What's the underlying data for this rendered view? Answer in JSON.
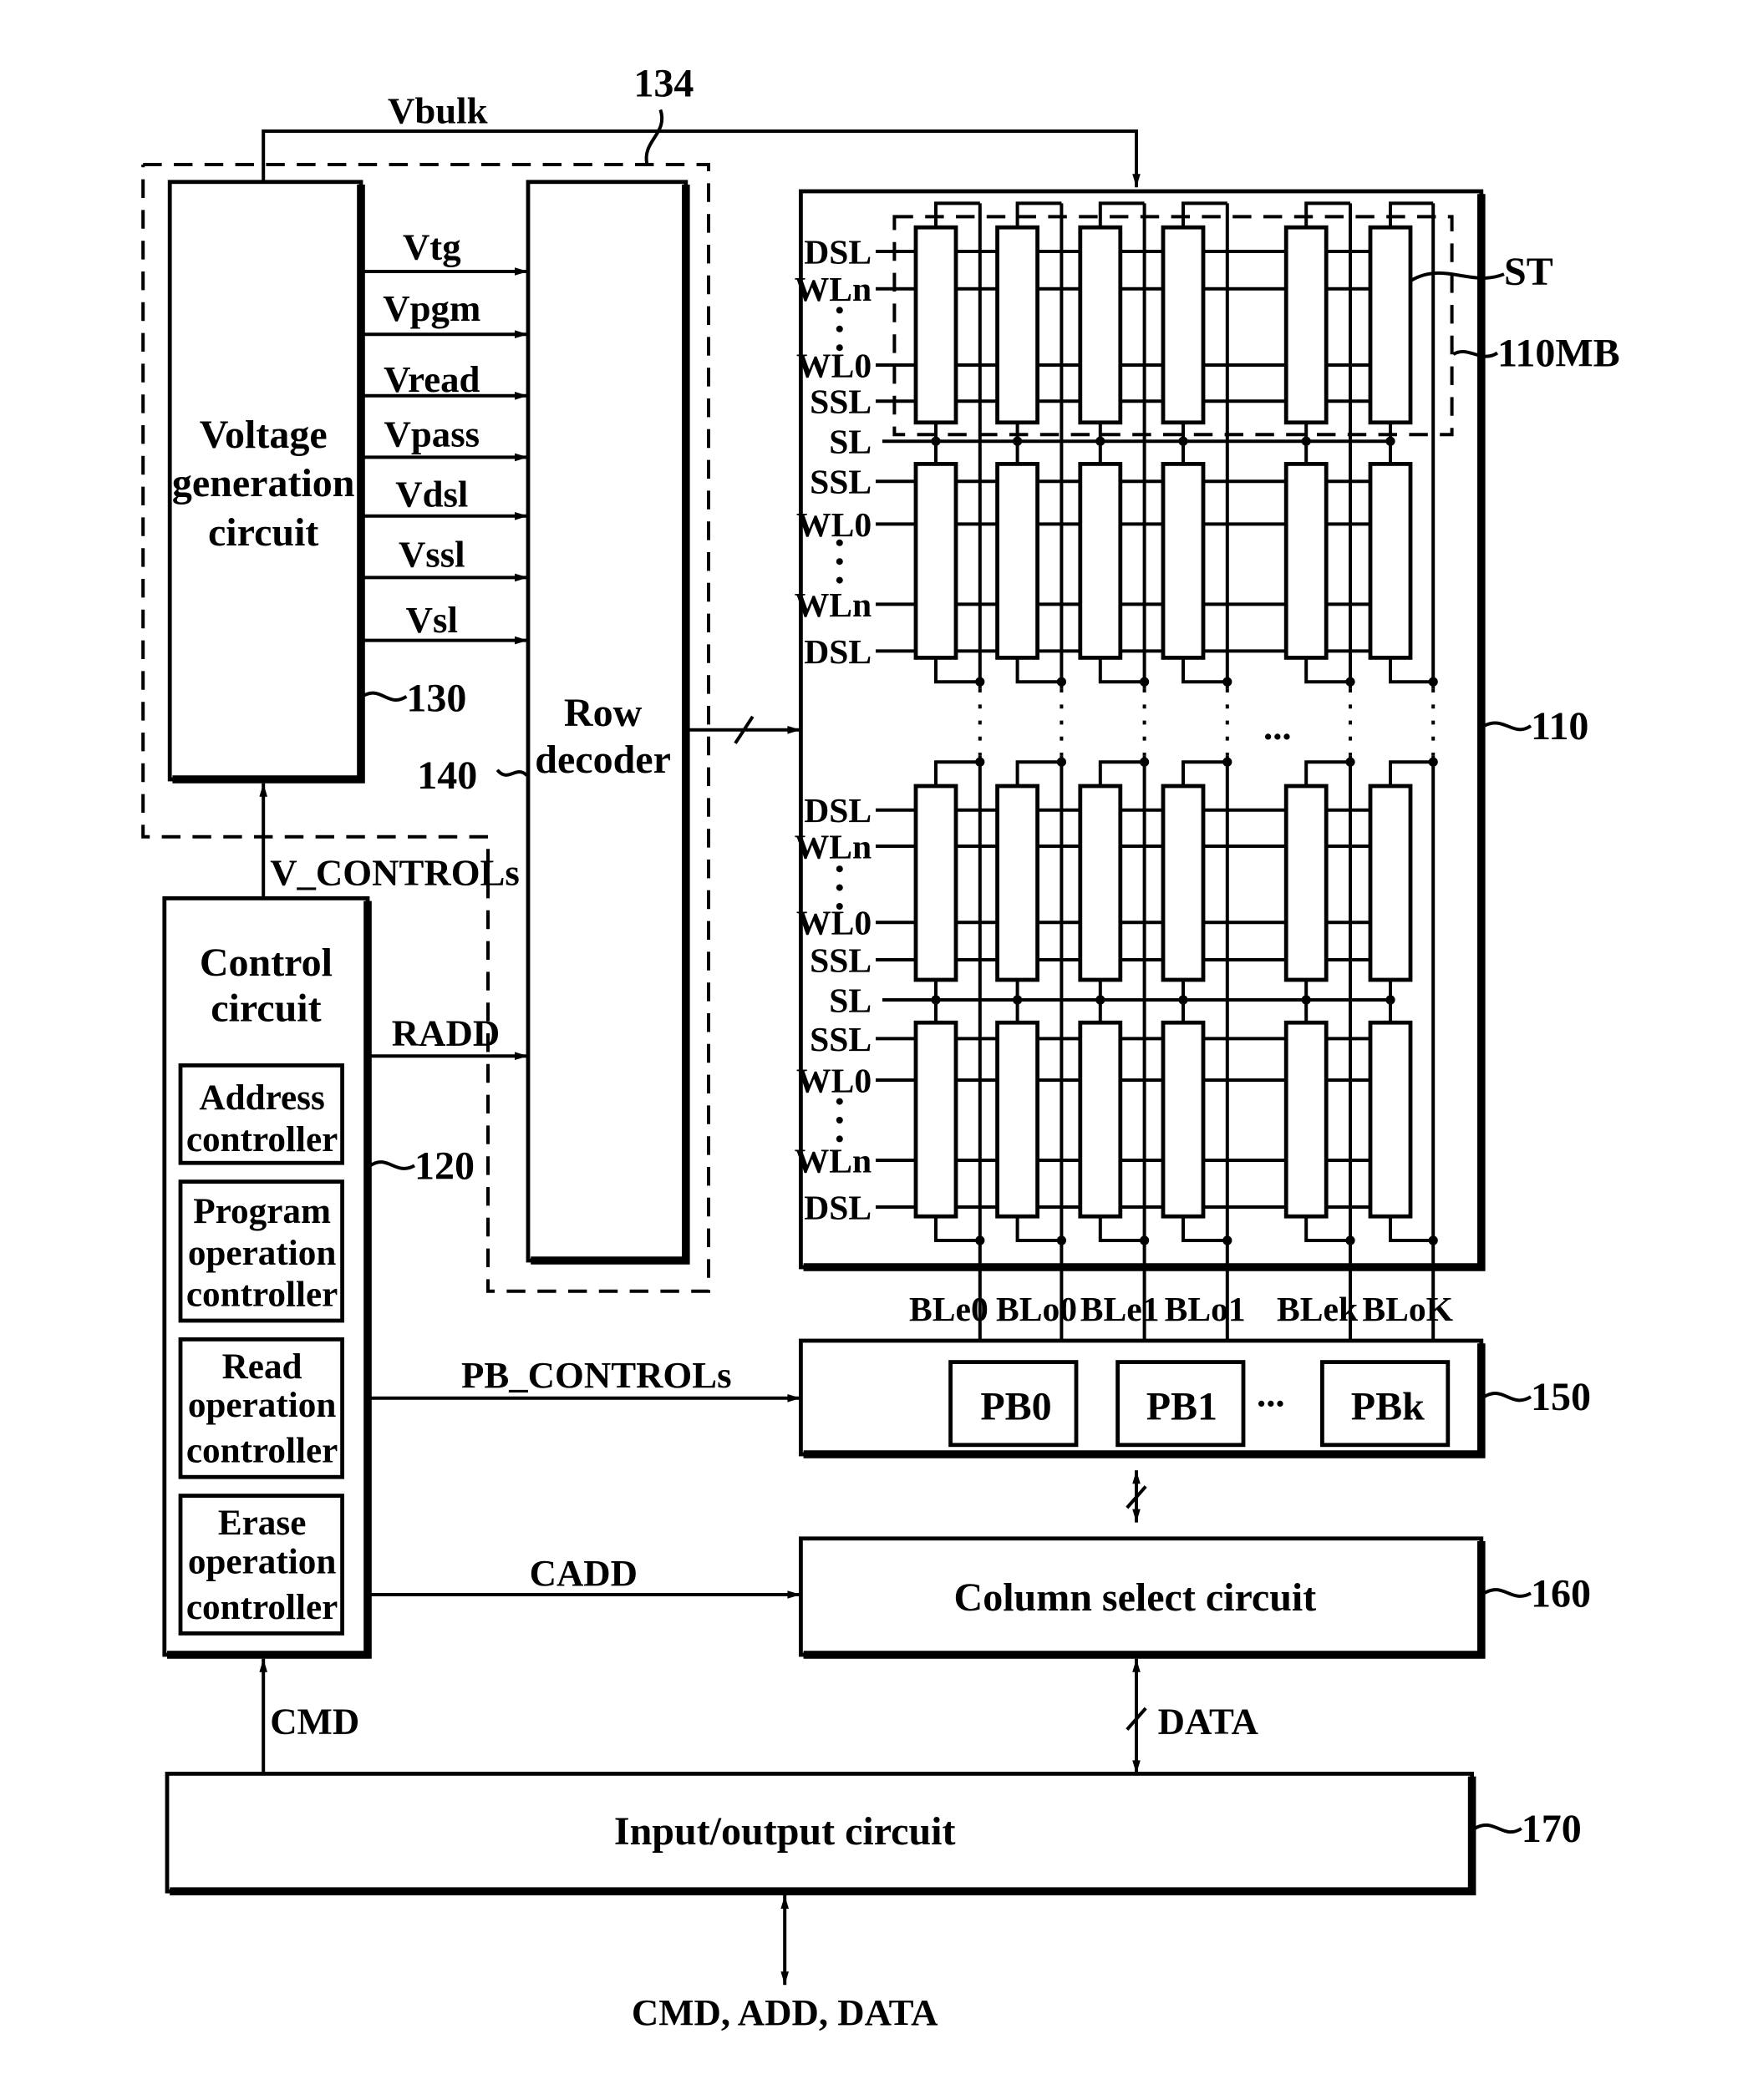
{
  "figure": {
    "voltage_generation": {
      "label_lines": [
        "Voltage",
        "generation",
        "circuit"
      ],
      "ref": "130"
    },
    "row_decoder": {
      "label_lines": [
        "Row",
        "decoder"
      ],
      "ref": "140"
    },
    "voltage_block_group_ref": "134",
    "voltage_signals": [
      "Vtg",
      "Vpgm",
      "Vread",
      "Vpass",
      "Vdsl",
      "Vssl",
      "Vsl"
    ],
    "vbulk_label": "Vbulk",
    "memory_array": {
      "ref": "110",
      "memory_block_ref": "110MB",
      "string_ref": "ST",
      "upper_rows": [
        "DSL",
        "WLn",
        "WL0",
        "SSL",
        "SL",
        "SSL",
        "WL0",
        "WLn",
        "DSL"
      ],
      "lower_rows": [
        "DSL",
        "WLn",
        "WL0",
        "SSL",
        "SL",
        "SSL",
        "WL0",
        "WLn",
        "DSL"
      ],
      "ellipsis": "..."
    },
    "bitlines": [
      "BLe0",
      "BLo0",
      "BLe1",
      "BLo1",
      "BLek",
      "BLoK"
    ],
    "page_buffer_group": {
      "ref": "150",
      "buffers": [
        "PB0",
        "PB1",
        "PBk"
      ],
      "ellipsis": "..."
    },
    "column_select": {
      "label": "Column select circuit",
      "ref": "160"
    },
    "control_circuit": {
      "label_lines": [
        "Control",
        "circuit"
      ],
      "ref": "120",
      "controllers": [
        {
          "lines": [
            "Address",
            "controller"
          ]
        },
        {
          "lines": [
            "Program",
            "operation",
            "controller"
          ]
        },
        {
          "lines": [
            "Read",
            "operation",
            "controller"
          ]
        },
        {
          "lines": [
            "Erase",
            "operation",
            "controller"
          ]
        }
      ]
    },
    "signals": {
      "v_controls": "V_CONTROLs",
      "radd": "RADD",
      "pb_controls": "PB_CONTROLs",
      "cadd": "CADD",
      "cmd": "CMD",
      "data": "DATA",
      "external": "CMD, ADD, DATA"
    },
    "io_circuit": {
      "label": "Input/output circuit",
      "ref": "170"
    }
  }
}
